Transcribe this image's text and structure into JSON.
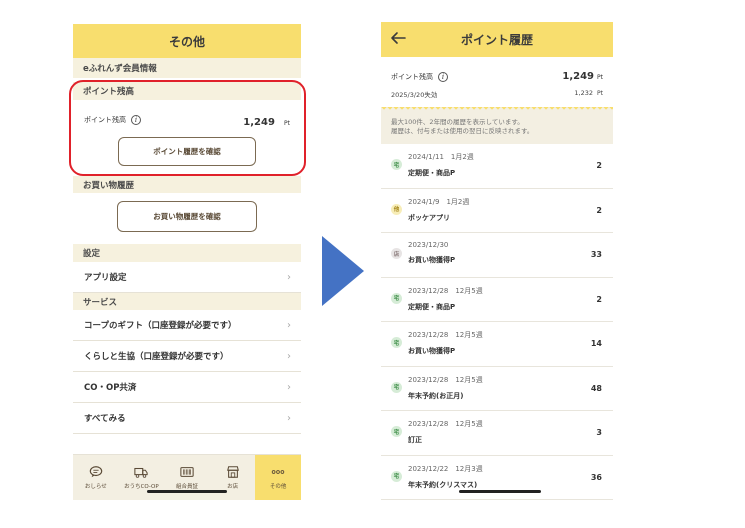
{
  "left": {
    "header_title": "その他",
    "member_section": "eふれんず会員情報",
    "points_section": "ポイント残高",
    "balance_label": "ポイント残高",
    "balance_value": "1,249",
    "balance_unit": "Pt",
    "history_button": "ポイント履歴を確認",
    "shopping_section": "お買い物履歴",
    "shopping_button": "お買い物履歴を確認",
    "settings_section": "設定",
    "app_settings": "アプリ設定",
    "services_section": "サービス",
    "service_rows": [
      "コープのギフト（口座登録が必要です）",
      "くらしと生協（口座登録が必要です）",
      "CO・OP共済",
      "すべてみる"
    ],
    "tabs": [
      "おしらせ",
      "おうちCO-OP",
      "組合員証",
      "お店",
      "その他"
    ]
  },
  "right": {
    "header_title": "ポイント履歴",
    "balance_label": "ポイント残高",
    "balance_value": "1,249",
    "balance_unit": "Pt",
    "expiry_label": "2025/3/20失効",
    "expiry_value": "1,232",
    "expiry_unit": "Pt",
    "note_line1": "最大100件、2年間の履歴を表示しています。",
    "note_line2": "履歴は、付与または使用の翌日に反映されます。",
    "history": [
      {
        "badge": "宅",
        "date": "2024/1/11　1月2週",
        "title": "定期便・商品P",
        "points": "2"
      },
      {
        "badge": "他",
        "date": "2024/1/9　1月2週",
        "title": "ポッケアプリ",
        "points": "2"
      },
      {
        "badge": "店",
        "date": "2023/12/30",
        "title": "お買い物獲得P",
        "points": "33"
      },
      {
        "badge": "宅",
        "date": "2023/12/28　12月5週",
        "title": "定期便・商品P",
        "points": "2"
      },
      {
        "badge": "宅",
        "date": "2023/12/28　12月5週",
        "title": "お買い物獲得P",
        "points": "14"
      },
      {
        "badge": "宅",
        "date": "2023/12/28　12月5週",
        "title": "年末予約(お正月)",
        "points": "48"
      },
      {
        "badge": "宅",
        "date": "2023/12/28　12月5週",
        "title": "訂正",
        "points": "3"
      },
      {
        "badge": "宅",
        "date": "2023/12/22　12月3週",
        "title": "年末予約(クリスマス)",
        "points": "36"
      }
    ]
  },
  "colors": {
    "brand_yellow": "#f8de6e",
    "highlight_red": "#e0212a",
    "arrow_blue": "#4472c4"
  }
}
